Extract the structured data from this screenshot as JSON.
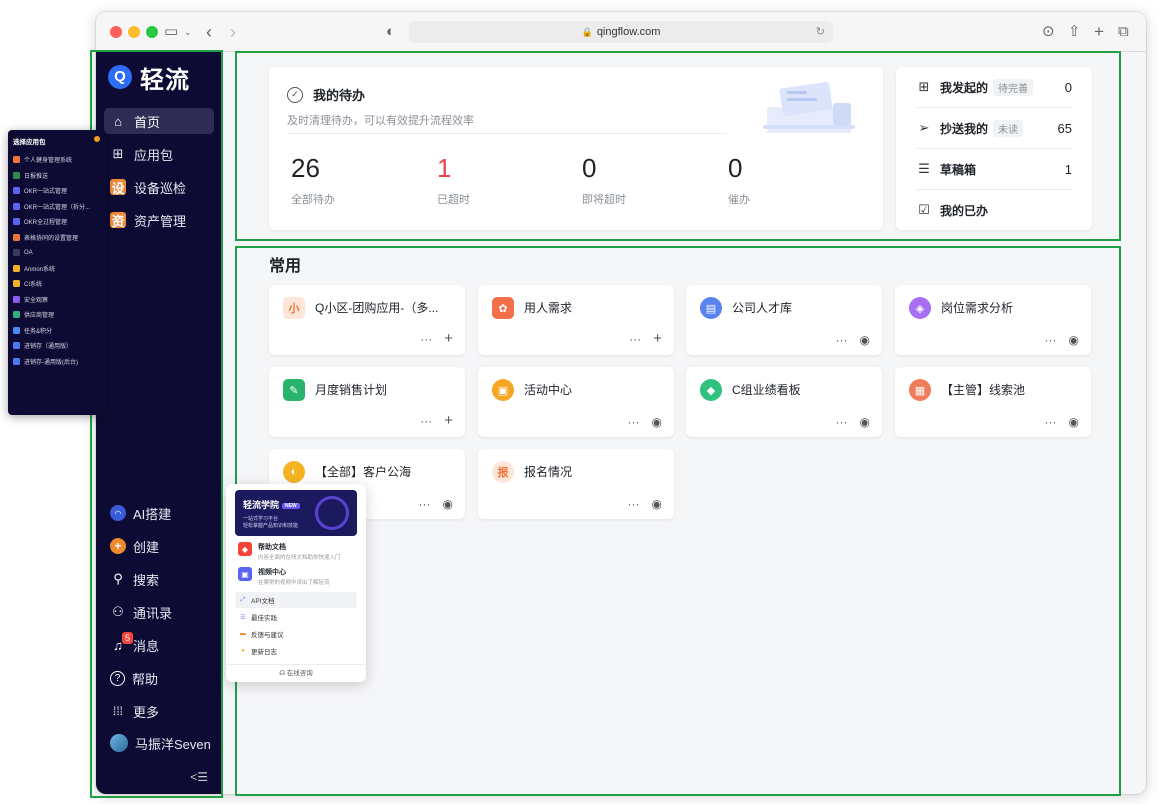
{
  "browser": {
    "url": "qingflow.com"
  },
  "sidebar": {
    "logo_text": "轻流",
    "nav": [
      {
        "label": "首页",
        "icon": "home-icon"
      },
      {
        "label": "应用包",
        "icon": "grid-icon"
      },
      {
        "label": "设备巡检",
        "icon": "设"
      },
      {
        "label": "资产管理",
        "icon": "资"
      }
    ],
    "bottom": [
      {
        "label": "AI搭建",
        "icon": "ai-icon"
      },
      {
        "label": "创建",
        "icon": "plus-circle-icon"
      },
      {
        "label": "搜索",
        "icon": "search-icon"
      },
      {
        "label": "通讯录",
        "icon": "contacts-icon"
      },
      {
        "label": "消息",
        "icon": "bell-icon",
        "badge": "5"
      },
      {
        "label": "帮助",
        "icon": "help-icon"
      },
      {
        "label": "更多",
        "icon": "more-grid-icon"
      },
      {
        "label": "马振洋Seven",
        "icon": "avatar"
      }
    ]
  },
  "app_package_list": {
    "title": "选择应用包",
    "items": [
      {
        "label": "个人健身管理系统",
        "color": "#f0743c"
      },
      {
        "label": "日报推送",
        "color": "#2e8a4a"
      },
      {
        "label": "OKR一站式管理",
        "color": "#5a62f0"
      },
      {
        "label": "OKR一站式管理（拆分...",
        "color": "#5a62f0"
      },
      {
        "label": "OKR全过程管理",
        "color": "#5a62f0"
      },
      {
        "label": "表格协同的设置管理",
        "color": "#f0743c"
      },
      {
        "label": "OA",
        "color": "#3a3a5a"
      },
      {
        "label": "Anmon系统",
        "color": "#f0b02c"
      },
      {
        "label": "CI系统",
        "color": "#f0b02c"
      },
      {
        "label": "安全观察",
        "color": "#8a5cf0"
      },
      {
        "label": "供应商管理",
        "color": "#2eb07a"
      },
      {
        "label": "任务&积分",
        "color": "#4a8af0"
      },
      {
        "label": "进销存（通用版）",
        "color": "#4a7af0"
      },
      {
        "label": "进销存-通用版(后台)",
        "color": "#4a7af0"
      }
    ]
  },
  "todo": {
    "title": "我的待办",
    "subtitle": "及时清理待办，可以有效提升流程效率",
    "stats": [
      {
        "value": "26",
        "label": "全部待办"
      },
      {
        "value": "1",
        "label": "已超时"
      },
      {
        "value": "0",
        "label": "即将超时"
      },
      {
        "value": "0",
        "label": "催办"
      }
    ]
  },
  "right_panel": [
    {
      "label": "我发起的",
      "tag": "待完善",
      "count": "0",
      "icon": "file-plus-icon"
    },
    {
      "label": "抄送我的",
      "tag": "未读",
      "count": "65",
      "icon": "send-icon"
    },
    {
      "label": "草稿箱",
      "tag": "",
      "count": "1",
      "icon": "draft-icon"
    },
    {
      "label": "我的已办",
      "tag": "",
      "count": "",
      "icon": "done-icon"
    }
  ],
  "common": {
    "title": "常用",
    "apps": [
      {
        "name": "Q小区-团购应用-（多...",
        "icon_text": "小",
        "color": "#fde6d8",
        "text_color": "#f0743c",
        "square": true,
        "action": "plus"
      },
      {
        "name": "用人需求",
        "icon_text": "✿",
        "color": "#f4704a",
        "text_color": "#ffffff",
        "square": true,
        "action": "plus"
      },
      {
        "name": "公司人才库",
        "icon_text": "▤",
        "color": "#5b83f0",
        "text_color": "#ffffff",
        "square": false,
        "action": "eye"
      },
      {
        "name": "岗位需求分析",
        "icon_text": "◈",
        "color": "#a86ef5",
        "text_color": "#ffffff",
        "square": false,
        "action": "eye"
      },
      {
        "name": "月度销售计划",
        "icon_text": "✎",
        "color": "#28b46c",
        "text_color": "#ffffff",
        "square": true,
        "action": "plus"
      },
      {
        "name": "活动中心",
        "icon_text": "▣",
        "color": "#f5a623",
        "text_color": "#ffffff",
        "square": false,
        "action": "eye"
      },
      {
        "name": "C组业绩看板",
        "icon_text": "◆",
        "color": "#2ec27e",
        "text_color": "#ffffff",
        "square": false,
        "action": "eye"
      },
      {
        "name": "【主管】线索池",
        "icon_text": "▦",
        "color": "#f07c5a",
        "text_color": "#ffffff",
        "square": false,
        "action": "eye"
      },
      {
        "name": "【全部】客户公海",
        "icon_text": "◐",
        "color": "#f5b323",
        "text_color": "#ffffff",
        "square": false,
        "action": "eye"
      },
      {
        "name": "报名情况",
        "icon_text": "报",
        "color": "#fde6d8",
        "text_color": "#f0743c",
        "square": false,
        "action": "eye"
      }
    ]
  },
  "help_popup": {
    "banner_title": "轻流学院",
    "banner_badge": "NEW",
    "banner_sub1": "一站式学习平台",
    "banner_sub2": "轻松掌握产品知识和技能",
    "entries": [
      {
        "title": "帮助文档",
        "sub": "内容全面的在线文档助你快速入门",
        "color": "#f5433a"
      },
      {
        "title": "视频中心",
        "sub": "在案例的视频中读出了解轻流",
        "color": "#5a62f0"
      }
    ],
    "links": [
      {
        "label": "API文档",
        "icon": "api-icon"
      },
      {
        "label": "最佳实践",
        "icon": "practice-icon"
      },
      {
        "label": "反馈与建议",
        "icon": "feedback-icon"
      },
      {
        "label": "更新日志",
        "icon": "changelog-icon"
      }
    ],
    "footer": "在线咨询"
  }
}
